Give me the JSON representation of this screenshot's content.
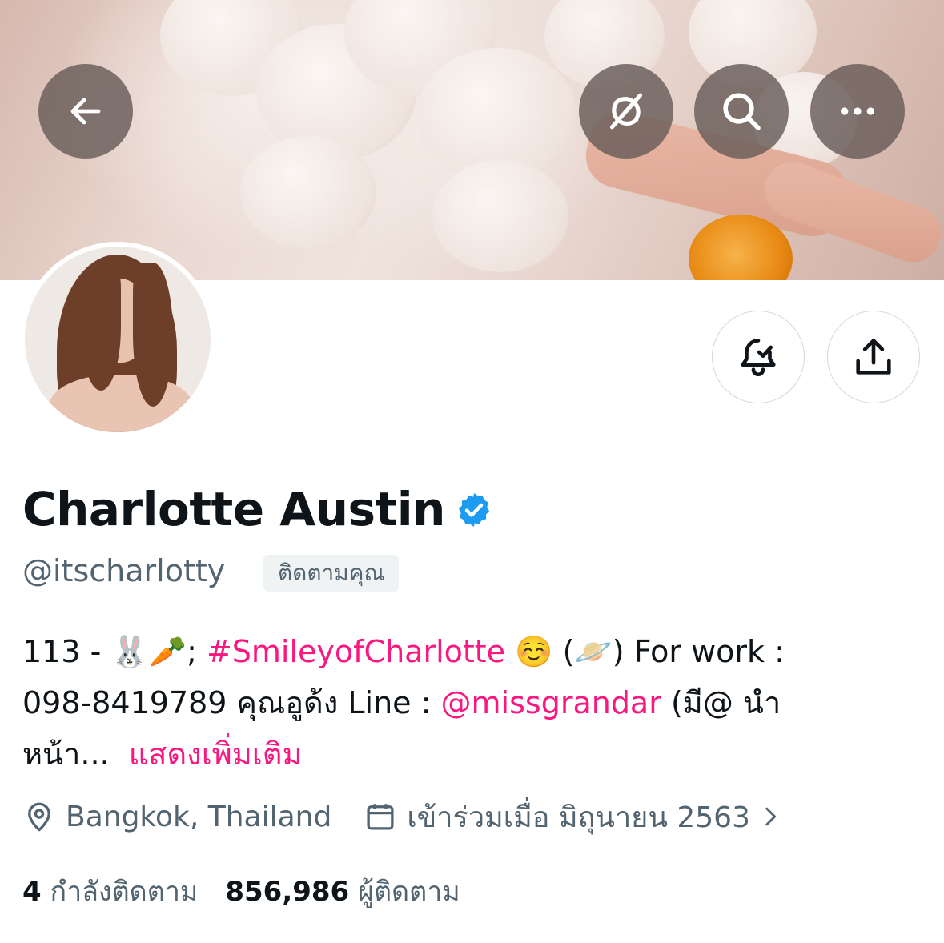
{
  "header": {
    "back_icon": "arrow-left-icon",
    "grok_icon": "grok-icon",
    "search_icon": "search-icon",
    "more_icon": "more-horizontal-icon"
  },
  "profile": {
    "display_name": "Charlotte Austin",
    "verified": true,
    "handle": "@itscharlotty",
    "follows_you_label": "ติดตามคุณ",
    "bio": {
      "prefix": "113 - ",
      "emoji_rabbit": "🐰",
      "emoji_carrot": "🥕",
      "sep": "; ",
      "hashtag": "#SmileyofCharlotte",
      "emoji_smile": "☺️",
      "paren_open": " (",
      "emoji_planet": "🪐",
      "paren_close_text": ") For work :",
      "line2": "098-8419789 คุณอูด้ง Line : ",
      "mention": "@missgrandar",
      "line2_tail": " (มี@ นำ",
      "line3": "หน้า... ",
      "show_more": "แสดงเพิ่มเติม"
    },
    "location": "Bangkok, Thailand",
    "joined": "เข้าร่วมเมื่อ มิถุนายน 2563",
    "following_count": "4",
    "following_label": "กำลังติดตาม",
    "followers_count": "856,986",
    "followers_label": "ผู้ติดตาม"
  },
  "actions": {
    "notify_icon": "bell-check-icon",
    "share_icon": "share-icon"
  },
  "colors": {
    "accent": "#f91880",
    "verified": "#1d9bf0",
    "secondary_text": "#536471"
  }
}
